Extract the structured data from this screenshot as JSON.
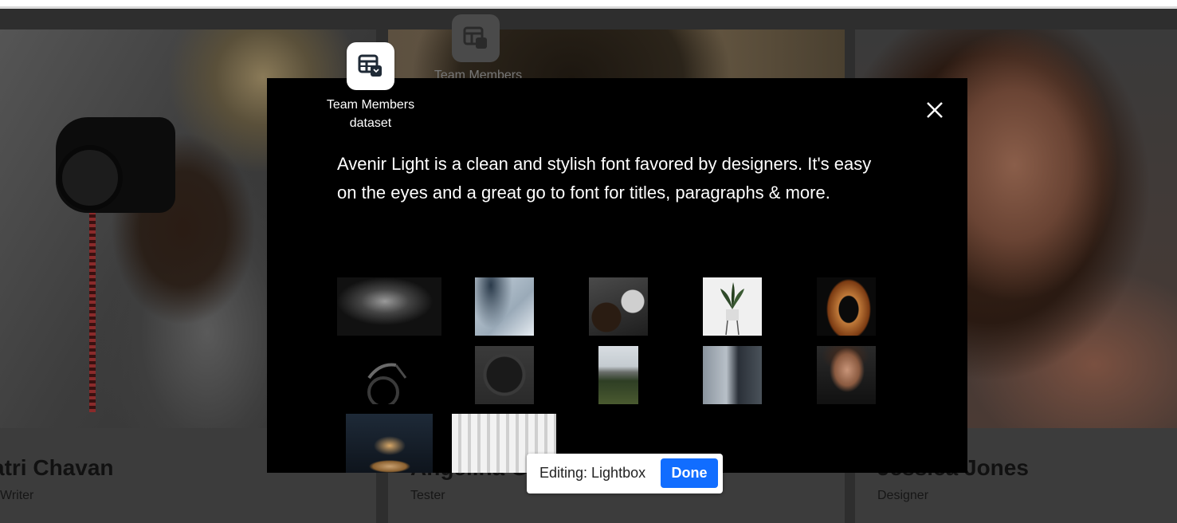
{
  "team_cards": [
    {
      "name": "atri Chavan",
      "role": "Writer"
    },
    {
      "name": "Angelina G",
      "role": "Tester"
    },
    {
      "name": "Jessica Jones",
      "role": "Designer"
    }
  ],
  "ghost_widget": {
    "label": "Team Members"
  },
  "dataset_widget": {
    "label_line1": "Team Members",
    "label_line2": "dataset",
    "icon": "dataset-table-icon"
  },
  "lightbox": {
    "text": "Avenir Light is a clean and stylish font favored by designers. It's easy on the eyes and a great go to font for titles, paragraphs & more.",
    "close_icon": "close-icon",
    "gallery": [
      "abstract-dark-texture",
      "blue-abstract-curve",
      "glass-and-stone",
      "potted-plant",
      "copper-knot",
      "bicycle",
      "wrist-watch",
      "mountain-valley",
      "building-facade",
      "man-portrait",
      "pancake-stack",
      "white-columns"
    ]
  },
  "edit_bar": {
    "label": "Editing: Lightbox",
    "done_label": "Done",
    "accent": "#116dff"
  }
}
